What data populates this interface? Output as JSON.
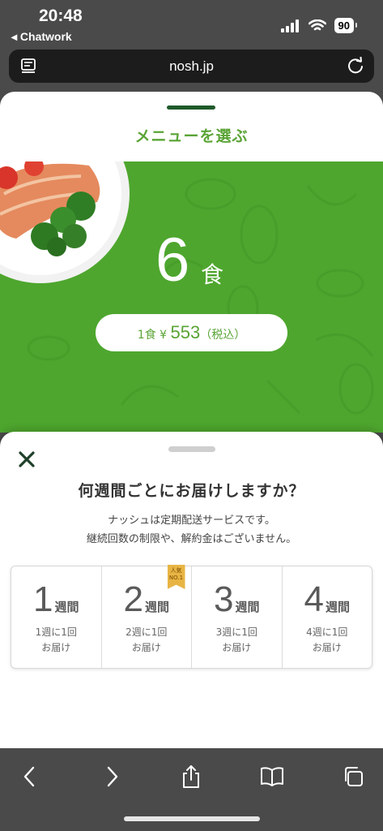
{
  "status_bar": {
    "time": "20:48",
    "back_app": "◂ Chatwork",
    "battery": "90"
  },
  "browser": {
    "url": "nosh.jp"
  },
  "menu_sheet": {
    "title": "メニューを選ぶ",
    "meal_count": "6",
    "meal_unit": "食",
    "price_prefix": "1食 ¥ ",
    "price_value": "553",
    "price_suffix": "（税込）"
  },
  "delivery_sheet": {
    "question": "何週間ごとにお届けしますか？",
    "subtitle_line1": "ナッシュは定期配送サービスです。",
    "subtitle_line2": "継続回数の制限や、解約金はございません。",
    "options": [
      {
        "num": "1",
        "unit": "週間",
        "desc1": "1週に1回",
        "desc2": "お届け"
      },
      {
        "num": "2",
        "unit": "週間",
        "desc1": "2週に1回",
        "desc2": "お届け",
        "badge1": "人気",
        "badge2": "NO.1"
      },
      {
        "num": "3",
        "unit": "週間",
        "desc1": "3週に1回",
        "desc2": "お届け"
      },
      {
        "num": "4",
        "unit": "週間",
        "desc1": "4週に1回",
        "desc2": "お届け"
      }
    ]
  },
  "icons": {
    "close": "close-icon",
    "tabs": "reader-icon",
    "reload": "reload-icon",
    "back": "chevron-left-icon",
    "forward": "chevron-right-icon",
    "share": "share-icon",
    "bookmarks": "book-icon",
    "tabs_overview": "tabs-icon"
  },
  "colors": {
    "brand_green": "#4ea62e",
    "title_green": "#5aa436",
    "dark_green": "#1f5a2a"
  }
}
